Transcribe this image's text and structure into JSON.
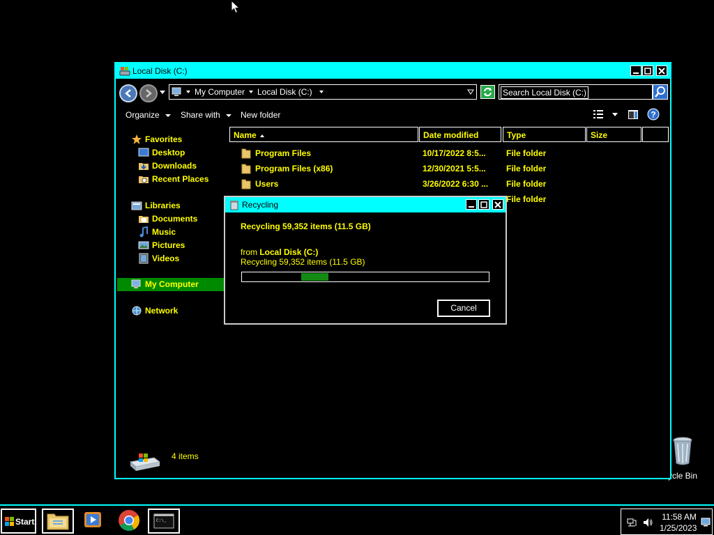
{
  "desktop": {
    "recycle_bin_label": "ycle Bin"
  },
  "explorer": {
    "title": "Local Disk (C:)",
    "breadcrumbs": [
      "My Computer",
      "Local Disk (C:)"
    ],
    "search_placeholder": "Search Local Disk (C:)",
    "toolbar": {
      "organize": "Organize",
      "share_with": "Share with",
      "new_folder": "New folder"
    },
    "nav": {
      "favorites": "Favorites",
      "desktop": "Desktop",
      "downloads": "Downloads",
      "recent_places": "Recent Places",
      "libraries": "Libraries",
      "documents": "Documents",
      "music": "Music",
      "pictures": "Pictures",
      "videos": "Videos",
      "my_computer": "My Computer",
      "network": "Network"
    },
    "columns": [
      "Name",
      "Date modified",
      "Type",
      "Size"
    ],
    "files": [
      {
        "name": "Program Files",
        "date": "10/17/2022 8:5...",
        "type": "File folder"
      },
      {
        "name": "Program Files (x86)",
        "date": "12/30/2021 5:5...",
        "type": "File folder"
      },
      {
        "name": "Users",
        "date": "3/26/2022 6:30 ...",
        "type": "File folder"
      },
      {
        "name": "",
        "date": "",
        "type": "File folder"
      }
    ],
    "status_count": "4 items"
  },
  "dialog": {
    "title": "Recycling",
    "headline": "Recycling 59,352 items (11.5 GB)",
    "from_prefix": "from ",
    "from_location": "Local Disk (C:)",
    "subline": "Recycling 59,352 items (11.5 GB)",
    "progress_start_fraction": 0.24,
    "progress_end_fraction": 0.35,
    "cancel_label": "Cancel"
  },
  "taskbar": {
    "start_label": "Start",
    "time": "11:58 AM",
    "date": "1/25/2023"
  },
  "colors": {
    "accent": "#00ffff",
    "text_highlight": "#ffff00",
    "selection": "#008a00",
    "progress": "#138a13"
  }
}
